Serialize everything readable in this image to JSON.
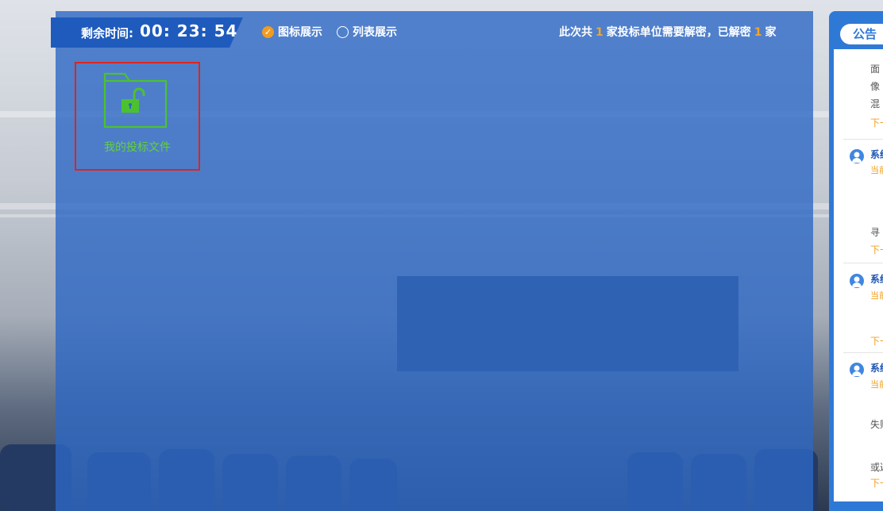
{
  "timer": {
    "label": "剩余时间:",
    "value": "00: 23: 54"
  },
  "view_options": [
    {
      "label": "图标展示",
      "selected": true
    },
    {
      "label": "列表展示",
      "selected": false
    }
  ],
  "summary": {
    "part1": "此次共",
    "total": "1",
    "part2": "家投标单位需要解密，已解密",
    "decrypted": "1",
    "part3": "家"
  },
  "file_tile": {
    "label": "我的投标文件",
    "icon": "unlocked-folder-icon",
    "color": "#4cc130"
  },
  "notice_panel": {
    "tab_label": "公告",
    "intro_lines": [
      "面",
      "像",
      "混"
    ],
    "next_label": "下一",
    "entries": [
      {
        "sender": "系统",
        "status": "当前",
        "text": "寻",
        "next": "下一"
      },
      {
        "sender": "系统",
        "status": "当前",
        "text": "",
        "next": "下一"
      },
      {
        "sender": "系统",
        "status": "当前",
        "text": "失败",
        "text2": "或返",
        "next": "下一"
      }
    ]
  },
  "colors": {
    "accent_orange": "#f29c1f",
    "panel_blue": "#2d68c4",
    "highlight_red": "#e1231b"
  }
}
